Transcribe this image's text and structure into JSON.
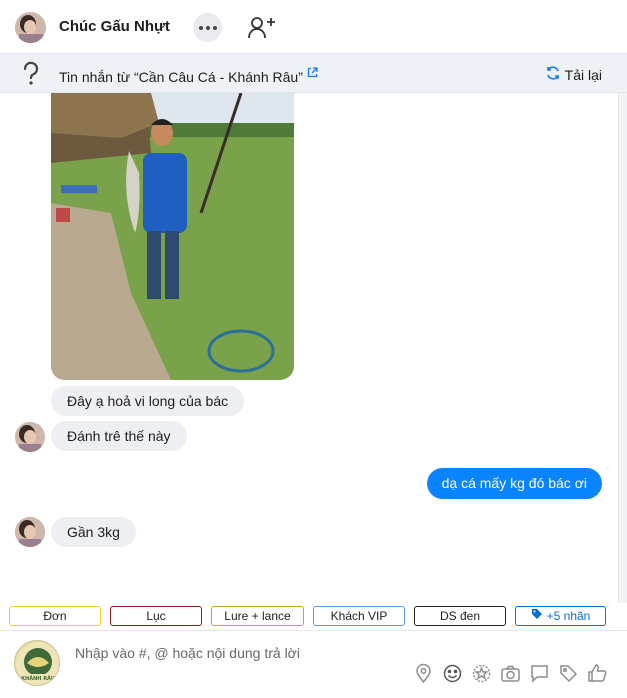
{
  "header": {
    "contact_name": "Chúc Gấu Nhựt"
  },
  "info_bar": {
    "message_from_label": "Tin nhắn từ  “Cần Câu Cá - Khánh Râu”",
    "reload_label": "Tải lại"
  },
  "messages": [
    {
      "direction": "incoming",
      "type": "image"
    },
    {
      "direction": "incoming",
      "text": "Đây ạ hoả vi long của bác"
    },
    {
      "direction": "incoming",
      "text": "Đánh trê thế này"
    },
    {
      "direction": "outgoing",
      "text": "dạ cá mấy kg đó bác ơi"
    },
    {
      "direction": "incoming",
      "text": "Gần 3kg"
    }
  ],
  "tags": [
    {
      "label": "Đơn",
      "color": "#f2d21b"
    },
    {
      "label": "Lục",
      "color": "#8b1a1a"
    },
    {
      "label": "Lure + lance",
      "color": "#c9a227"
    },
    {
      "label": "Khách VIP",
      "color": "#5b9bd5"
    },
    {
      "label": "DS đen",
      "color": "#222222"
    },
    {
      "label": "+5 nhãn",
      "color": "#0a6ed1"
    }
  ],
  "composer": {
    "placeholder": "Nhập vào #, @ hoặc nội dung trả lời",
    "page_logo_text": "KHÁNH RÂU",
    "tools": [
      "location-icon",
      "emoji-icon",
      "sticker-icon",
      "camera-icon",
      "chat-template-icon",
      "tag-icon",
      "like-icon"
    ]
  },
  "colors": {
    "accent": "#0a84ff",
    "incoming_bubble": "#eeeff2",
    "info_bar_bg": "#eef1f6"
  }
}
